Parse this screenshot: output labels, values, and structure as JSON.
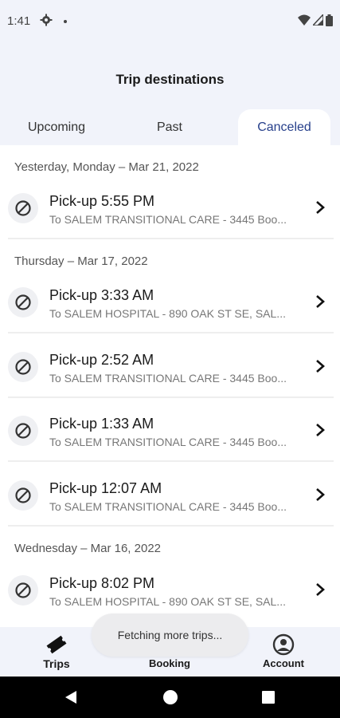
{
  "status_bar": {
    "time": "1:41"
  },
  "header": {
    "title": "Trip destinations"
  },
  "tabs": [
    {
      "label": "Upcoming"
    },
    {
      "label": "Past"
    },
    {
      "label": "Canceled"
    }
  ],
  "sections": [
    {
      "date": "Yesterday, Monday – Mar 21, 2022",
      "trips": [
        {
          "title": "Pick-up 5:55 PM",
          "subtitle": "To SALEM TRANSITIONAL CARE - 3445 Boo..."
        }
      ]
    },
    {
      "date": "Thursday – Mar 17, 2022",
      "trips": [
        {
          "title": "Pick-up 3:33 AM",
          "subtitle": "To SALEM HOSPITAL - 890 OAK ST SE, SAL..."
        },
        {
          "title": "Pick-up 2:52 AM",
          "subtitle": "To SALEM TRANSITIONAL CARE - 3445 Boo..."
        },
        {
          "title": "Pick-up 1:33 AM",
          "subtitle": "To SALEM TRANSITIONAL CARE - 3445 Boo..."
        },
        {
          "title": "Pick-up 12:07 AM",
          "subtitle": "To SALEM TRANSITIONAL CARE - 3445 Boo..."
        }
      ]
    },
    {
      "date": "Wednesday – Mar 16, 2022",
      "trips": [
        {
          "title": "Pick-up 8:02 PM",
          "subtitle": "To SALEM HOSPITAL - 890 OAK ST SE, SAL..."
        }
      ]
    }
  ],
  "toast": "Fetching more trips...",
  "bottom_nav": [
    {
      "label": "Trips",
      "icon": "ticket-icon"
    },
    {
      "label": "Booking",
      "icon": "car-icon"
    },
    {
      "label": "Account",
      "icon": "account-icon"
    }
  ],
  "colors": {
    "accent": "#27408b",
    "surface": "#f1f3fa"
  }
}
